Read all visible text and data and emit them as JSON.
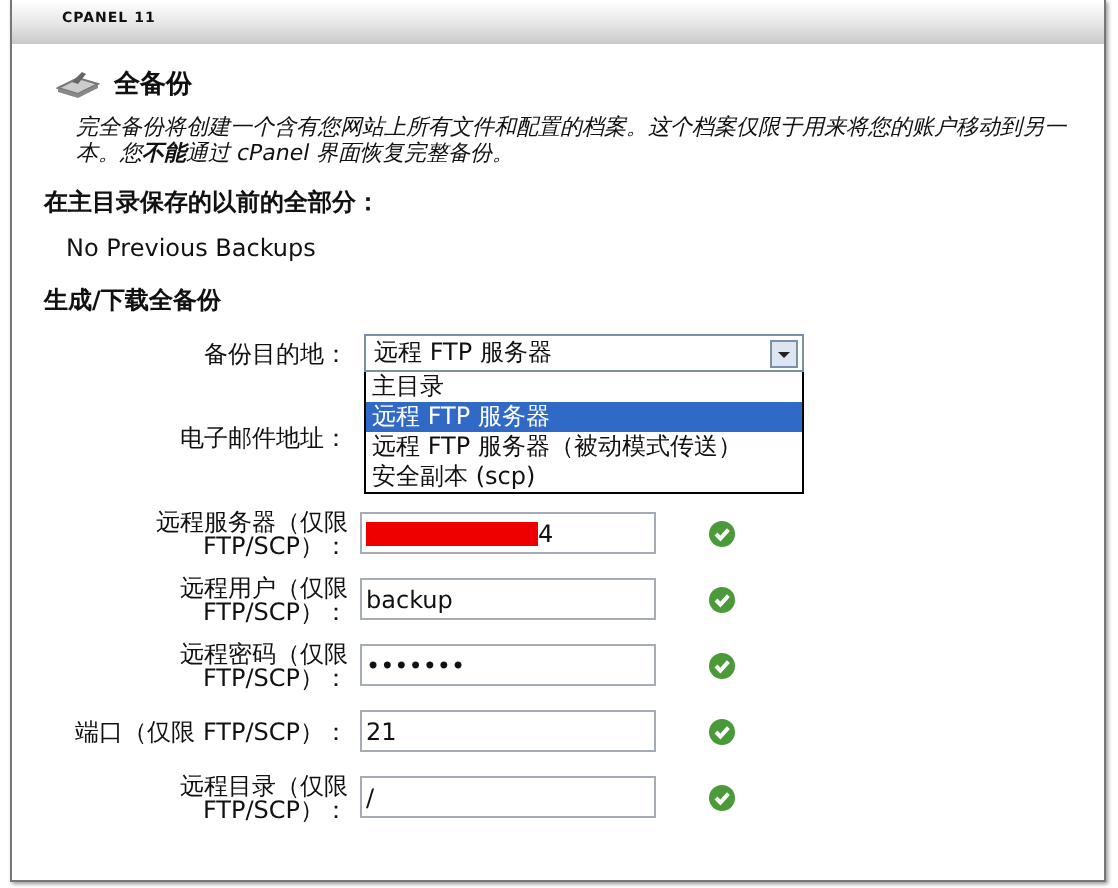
{
  "header": {
    "title": "CPANEL 11"
  },
  "section": {
    "title": "全备份",
    "description": [
      "完全备份将创建一个含有您网站上所有文件和配置的档案。这个档案仅限于用来将您的账户移动到另一",
      "本。您**不能**通过 cPanel 界面恢复完整备份。"
    ]
  },
  "previous": {
    "heading": "在主目录保存的以前的全部分：",
    "text": "No Previous Backups"
  },
  "generate": {
    "heading": "生成/下载全备份",
    "destination": {
      "label": "备份目的地：",
      "value": "远程 FTP 服务器",
      "expanded": true,
      "options": [
        {
          "label": "主目录",
          "selected": false
        },
        {
          "label": "远程 FTP 服务器",
          "selected": true
        },
        {
          "label": "远程 FTP 服务器（被动模式传送）",
          "selected": false
        },
        {
          "label": "安全副本 (scp)",
          "selected": false
        }
      ]
    },
    "email": {
      "label": "电子邮件地址："
    },
    "fields": [
      {
        "label_lines": [
          "远程服务器（仅限",
          "FTP/SCP）："
        ],
        "value": "4",
        "redacted": true,
        "valid": true
      },
      {
        "label_lines": [
          "远程用户（仅限",
          "FTP/SCP）："
        ],
        "value": "backup",
        "redacted": false,
        "valid": true
      },
      {
        "label_lines": [
          "远程密码（仅限",
          "FTP/SCP）："
        ],
        "value": "•••••••",
        "redacted": false,
        "valid": true
      },
      {
        "label_lines": [
          "端口（仅限 FTP/SCP）："
        ],
        "value": "21",
        "redacted": false,
        "valid": true
      },
      {
        "label_lines": [
          "远程目录（仅限",
          "FTP/SCP）："
        ],
        "value": "/",
        "redacted": false,
        "valid": true
      }
    ]
  }
}
